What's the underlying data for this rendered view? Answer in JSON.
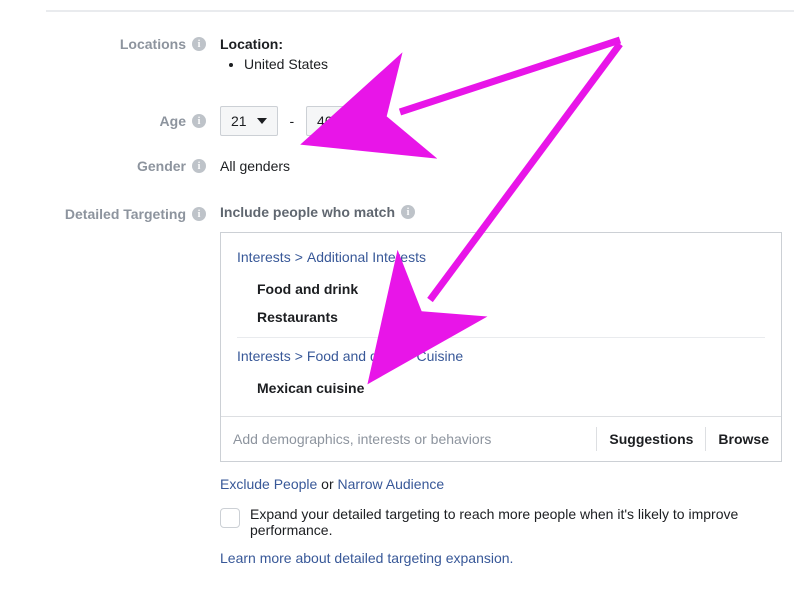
{
  "labels": {
    "locations": "Locations",
    "age": "Age",
    "gender": "Gender",
    "detailed": "Detailed Targeting"
  },
  "location": {
    "header": "Location:",
    "items": [
      "United States"
    ]
  },
  "age": {
    "min": "21",
    "max": "40",
    "dash": "-"
  },
  "gender": {
    "value": "All genders"
  },
  "detailed": {
    "include_label": "Include people who match",
    "groups": [
      {
        "crumbs": [
          "Interests",
          "Additional Interests"
        ],
        "items": [
          "Food and drink",
          "Restaurants"
        ]
      },
      {
        "crumbs": [
          "Interests",
          "Food and drink",
          "Cuisine"
        ],
        "items": [
          "Mexican cuisine"
        ]
      }
    ],
    "input_placeholder": "Add demographics, interests or behaviors",
    "suggestions": "Suggestions",
    "browse": "Browse",
    "exclude": "Exclude People",
    "or": " or ",
    "narrow": "Narrow Audience",
    "expand_label": "Expand your detailed targeting to reach more people when it's likely to improve performance.",
    "learn_more": "Learn more about detailed targeting expansion."
  }
}
